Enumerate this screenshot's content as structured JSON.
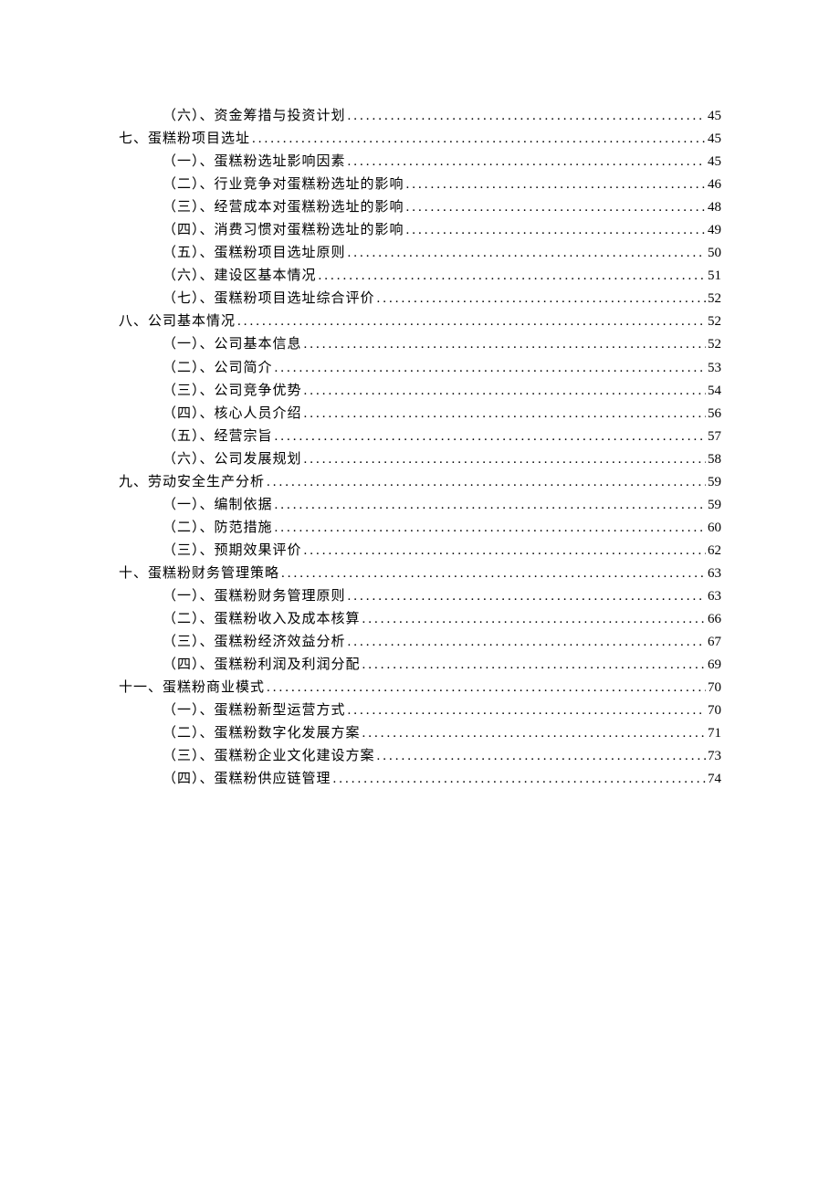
{
  "toc": [
    {
      "level": 2,
      "label": "（六）、资金筹措与投资计划",
      "page": "45"
    },
    {
      "level": 1,
      "label": "七、蛋糕粉项目选址",
      "page": "45"
    },
    {
      "level": 2,
      "label": "（一）、蛋糕粉选址影响因素",
      "page": "45"
    },
    {
      "level": 2,
      "label": "（二）、行业竞争对蛋糕粉选址的影响",
      "page": "46"
    },
    {
      "level": 2,
      "label": "（三）、经营成本对蛋糕粉选址的影响",
      "page": "48"
    },
    {
      "level": 2,
      "label": "（四）、消费习惯对蛋糕粉选址的影响",
      "page": "49"
    },
    {
      "level": 2,
      "label": "（五）、蛋糕粉项目选址原则",
      "page": "50"
    },
    {
      "level": 2,
      "label": "（六）、建设区基本情况",
      "page": "51"
    },
    {
      "level": 2,
      "label": "（七）、蛋糕粉项目选址综合评价",
      "page": "52"
    },
    {
      "level": 1,
      "label": "八、公司基本情况",
      "page": "52"
    },
    {
      "level": 2,
      "label": "（一）、公司基本信息",
      "page": "52"
    },
    {
      "level": 2,
      "label": "（二）、公司简介",
      "page": "53"
    },
    {
      "level": 2,
      "label": "（三）、公司竞争优势",
      "page": "54"
    },
    {
      "level": 2,
      "label": "（四）、核心人员介绍",
      "page": "56"
    },
    {
      "level": 2,
      "label": "（五）、经营宗旨",
      "page": "57"
    },
    {
      "level": 2,
      "label": "（六）、公司发展规划",
      "page": "58"
    },
    {
      "level": 1,
      "label": "九、劳动安全生产分析",
      "page": "59"
    },
    {
      "level": 2,
      "label": "（一）、编制依据",
      "page": "59"
    },
    {
      "level": 2,
      "label": "（二）、防范措施",
      "page": "60"
    },
    {
      "level": 2,
      "label": "（三）、预期效果评价",
      "page": "62"
    },
    {
      "level": 1,
      "label": "十、蛋糕粉财务管理策略",
      "page": "63"
    },
    {
      "level": 2,
      "label": "（一）、蛋糕粉财务管理原则",
      "page": "63"
    },
    {
      "level": 2,
      "label": "（二）、蛋糕粉收入及成本核算",
      "page": "66"
    },
    {
      "level": 2,
      "label": "（三）、蛋糕粉经济效益分析",
      "page": "67"
    },
    {
      "level": 2,
      "label": "（四）、蛋糕粉利润及利润分配",
      "page": "69"
    },
    {
      "level": 1,
      "label": "十一、蛋糕粉商业模式",
      "page": "70"
    },
    {
      "level": 2,
      "label": "（一）、蛋糕粉新型运营方式",
      "page": "70"
    },
    {
      "level": 2,
      "label": "（二）、蛋糕粉数字化发展方案",
      "page": "71"
    },
    {
      "level": 2,
      "label": "（三）、蛋糕粉企业文化建设方案",
      "page": "73"
    },
    {
      "level": 2,
      "label": "（四）、蛋糕粉供应链管理",
      "page": "74"
    }
  ]
}
